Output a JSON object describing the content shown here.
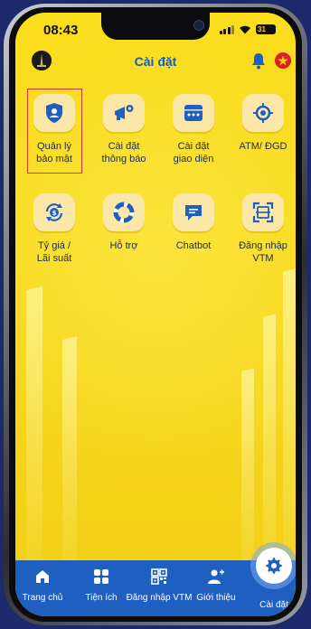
{
  "status_bar": {
    "time": "08:43",
    "battery": "31"
  },
  "header": {
    "title": "Cài đặt"
  },
  "grid": [
    {
      "label_line1": "Quản lý",
      "label_line2": "bảo mật",
      "icon": "shield-user-icon"
    },
    {
      "label_line1": "Cài đặt",
      "label_line2": "thông báo",
      "icon": "megaphone-gear-icon"
    },
    {
      "label_line1": "Cài đặt",
      "label_line2": "giao diện",
      "icon": "window-icon"
    },
    {
      "label_line1": "ATM/ ĐGD",
      "label_line2": "",
      "icon": "location-target-icon"
    },
    {
      "label_line1": "Tỷ giá /",
      "label_line2": "Lãi suất",
      "icon": "exchange-rate-icon"
    },
    {
      "label_line1": "Hỗ trợ",
      "label_line2": "",
      "icon": "lifebuoy-icon"
    },
    {
      "label_line1": "Chatbot",
      "label_line2": "",
      "icon": "chat-icon"
    },
    {
      "label_line1": "Đăng nhập",
      "label_line2": "VTM",
      "icon": "scan-icon"
    }
  ],
  "bottom_nav": [
    {
      "label": "Trang chủ",
      "icon": "home-icon"
    },
    {
      "label": "Tiện ích",
      "icon": "apps-grid-icon"
    },
    {
      "label": "Đăng nhập VTM",
      "icon": "qr-code-icon"
    },
    {
      "label": "Giới thiệu",
      "icon": "add-user-icon"
    },
    {
      "label": "Cài đặt",
      "icon": "gear-icon"
    }
  ],
  "colors": {
    "accent": "#1e5fbf",
    "background": "#f5d81c",
    "tile": "#fbe7a8",
    "selection": "#d23a2f"
  }
}
